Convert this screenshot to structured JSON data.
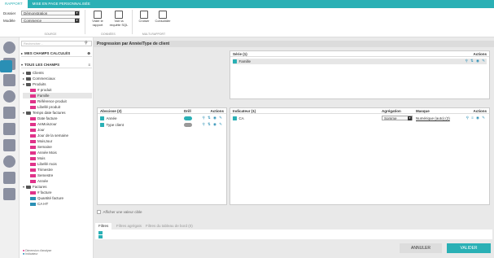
{
  "topbar": {
    "tabs": [
      "RAPPORT",
      "MISE EN PAGE PERSONNALISÉE"
    ]
  },
  "ribbon": {
    "dossier_label": "Dossier",
    "dossier_value": "Démonstration",
    "modele_label": "Modèle",
    "modele_value": "Commerce",
    "group_source": "SOURCE",
    "group_donnees": "DONNÉES",
    "group_multi": "MULTI-RAPPORT",
    "btn_vider": "Vider le rapport",
    "btn_voir_sql": "Voir la requête SQL",
    "btn_croiser": "Croiser",
    "btn_consolider": "Consolider"
  },
  "sidebar": {
    "search_placeholder": "Rechercher...",
    "calc_header": "MES CHAMPS CALCULÉS",
    "all_header": "TOUS LES CHAMPS",
    "tree": [
      {
        "label": "Clients",
        "type": "folder",
        "indent": 0
      },
      {
        "label": "Commerciaux",
        "type": "folder",
        "indent": 0
      },
      {
        "label": "Produits",
        "type": "folder",
        "indent": 0
      },
      {
        "label": "# produit",
        "type": "field",
        "indent": 1
      },
      {
        "label": "Famille",
        "type": "field",
        "indent": 1,
        "selected": true
      },
      {
        "label": "Référence produit",
        "type": "field",
        "indent": 1
      },
      {
        "label": "Libellé produit",
        "type": "field",
        "indent": 1
      },
      {
        "label": "Temps date factures",
        "type": "folder",
        "indent": 0
      },
      {
        "label": "Date facture",
        "type": "field",
        "indent": 1
      },
      {
        "label": "AnMoisJour",
        "type": "field",
        "indent": 1
      },
      {
        "label": "Jour",
        "type": "field",
        "indent": 1
      },
      {
        "label": "Jour de la semaine",
        "type": "field",
        "indent": 1
      },
      {
        "label": "MoisJour",
        "type": "field",
        "indent": 1
      },
      {
        "label": "Semaine",
        "type": "field",
        "indent": 1
      },
      {
        "label": "Année Mois",
        "type": "field",
        "indent": 1
      },
      {
        "label": "Mois",
        "type": "field",
        "indent": 1
      },
      {
        "label": "Libellé mois",
        "type": "field",
        "indent": 1
      },
      {
        "label": "Trimestre",
        "type": "field",
        "indent": 1
      },
      {
        "label": "Semestre",
        "type": "field",
        "indent": 1
      },
      {
        "label": "Année",
        "type": "field",
        "indent": 1
      },
      {
        "label": "Factures",
        "type": "folder",
        "indent": 0
      },
      {
        "label": "# facture",
        "type": "field",
        "indent": 1
      },
      {
        "label": "Quantité facture",
        "type": "measure",
        "indent": 1
      },
      {
        "label": "CA HT",
        "type": "measure",
        "indent": 1
      }
    ],
    "legend_1": "Dimension d'analyse",
    "legend_2": "Indicateur"
  },
  "main": {
    "title": "Progression par Année/Type de client",
    "serie_header": "Série (1)",
    "serie_actions": "Actions",
    "serie_row": "Famille",
    "abscisse_header": "Abscisse (2)",
    "drill_header": "Drill",
    "abscisse_actions": "Actions",
    "abscisse_rows": [
      "Année",
      "Type client"
    ],
    "indicateur_header": "Indicateur (1)",
    "aggregation_header": "Agrégation",
    "masque_header": "Masque",
    "indicateur_actions": "Actions",
    "indicateur_row": "CA",
    "aggregation_value": "Somme",
    "masque_value": "Numérique (auto) (2)",
    "afficher_label": "Afficher une valeur cible",
    "filter_tabs": [
      "Filtres",
      "Filtres agrégats",
      "Filtres du tableau de bord (0)"
    ],
    "cancel_label": "ANNULER",
    "validate_label": "VALIDER"
  },
  "colors": {
    "accent": "#2ab0b5",
    "dimension": "#e0338a",
    "measure": "#2a8fb5"
  }
}
